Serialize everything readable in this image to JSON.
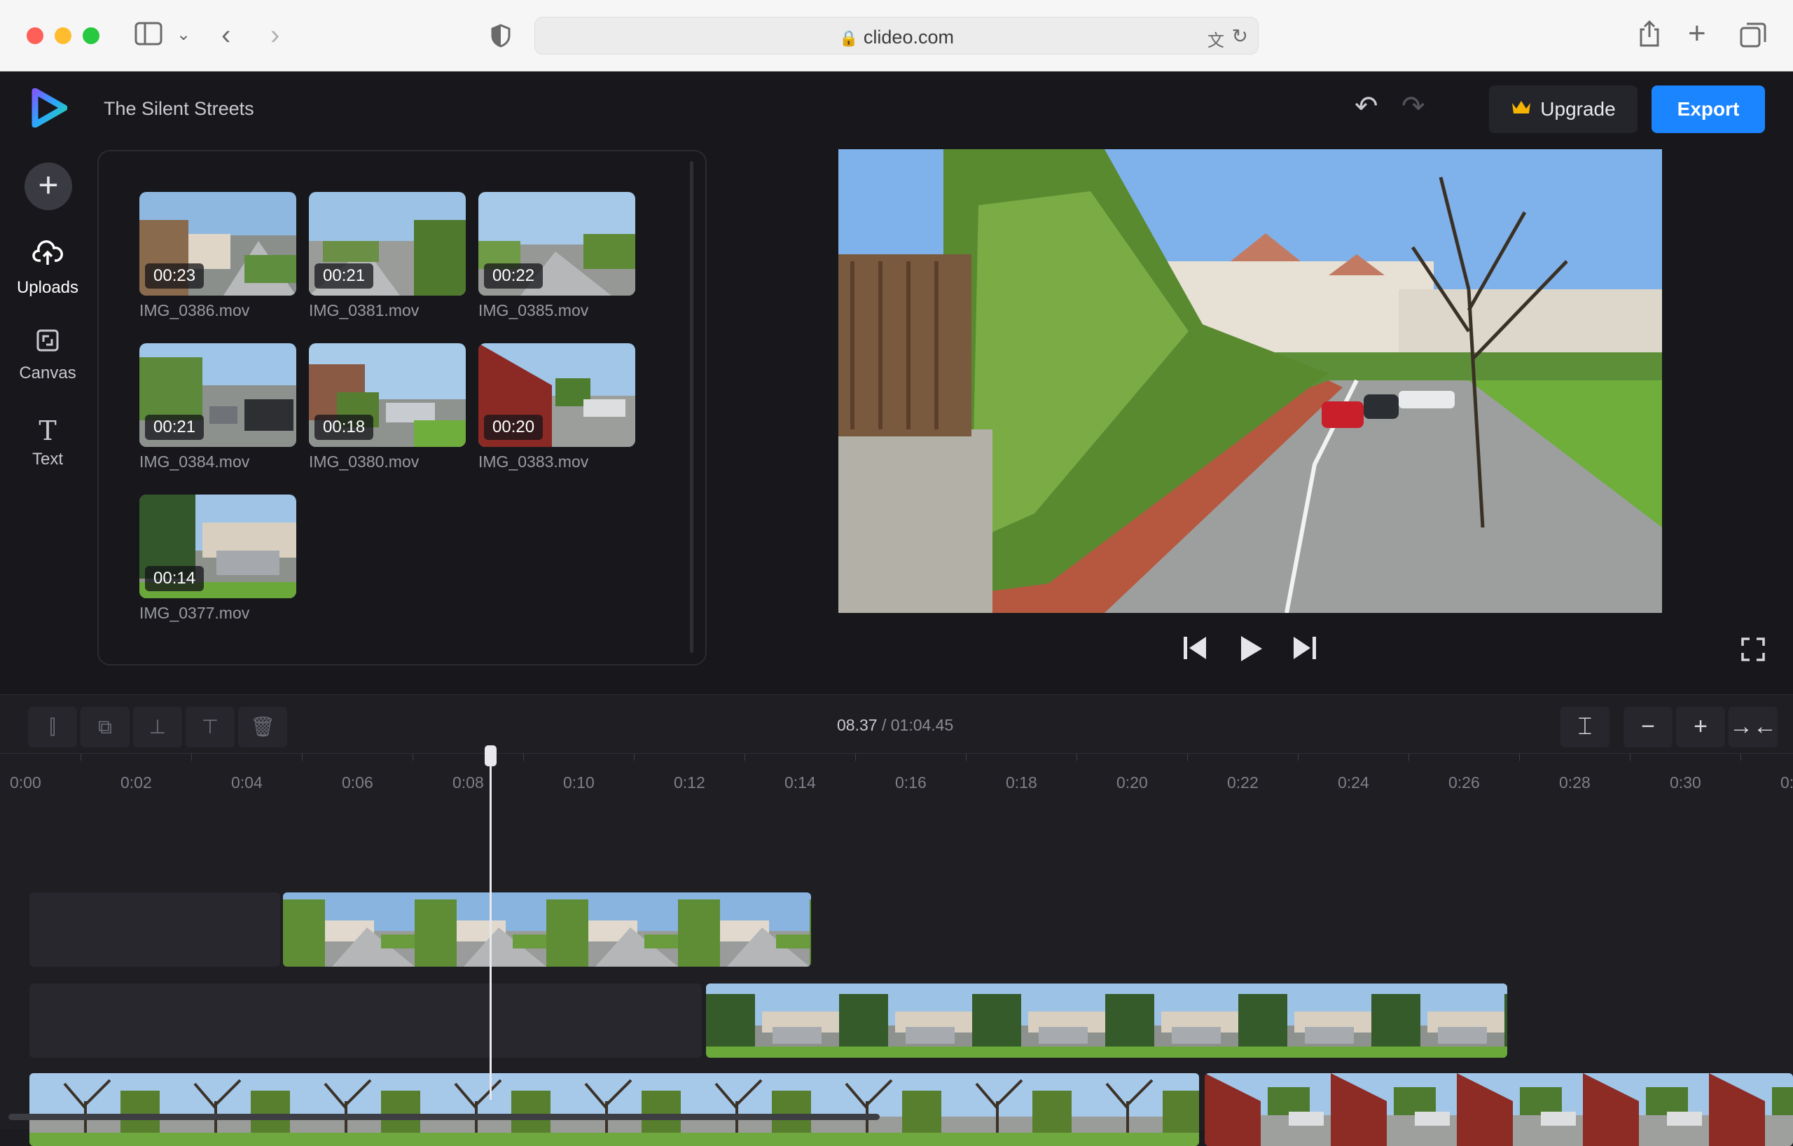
{
  "browser": {
    "url": "clideo.com",
    "icons": [
      "sidebar-icon",
      "chevron-down-icon",
      "back-icon",
      "forward-icon",
      "shield-icon",
      "lock-icon",
      "translate-icon",
      "reload-icon",
      "share-icon",
      "new-tab-icon",
      "tabs-icon"
    ]
  },
  "header": {
    "project_title": "The Silent Streets",
    "upgrade_label": "Upgrade",
    "export_label": "Export"
  },
  "sidebar": {
    "items": [
      {
        "label": "Uploads",
        "icon": "cloud-upload-icon"
      },
      {
        "label": "Canvas",
        "icon": "canvas-icon"
      },
      {
        "label": "Text",
        "icon": "text-icon"
      }
    ]
  },
  "media": {
    "items": [
      {
        "duration": "00:23",
        "name": "IMG_0386.mov"
      },
      {
        "duration": "00:21",
        "name": "IMG_0381.mov"
      },
      {
        "duration": "00:22",
        "name": "IMG_0385.mov"
      },
      {
        "duration": "00:21",
        "name": "IMG_0384.mov"
      },
      {
        "duration": "00:18",
        "name": "IMG_0380.mov"
      },
      {
        "duration": "00:20",
        "name": "IMG_0383.mov"
      },
      {
        "duration": "00:14",
        "name": "IMG_0377.mov"
      }
    ]
  },
  "timeline": {
    "current_time": "08.37",
    "separator": "/",
    "total_time": "01:04.45",
    "ruler_labels": [
      "0:00",
      "0:02",
      "0:04",
      "0:06",
      "0:08",
      "0:10",
      "0:12",
      "0:14",
      "0:16",
      "0:18",
      "0:20",
      "0:22",
      "0:24",
      "0:26",
      "0:28",
      "0:30",
      "0:"
    ]
  },
  "colors": {
    "accent": "#1b84ff",
    "background": "#18181c",
    "panel_border": "#2a2a31",
    "crown": "#f5b400"
  }
}
